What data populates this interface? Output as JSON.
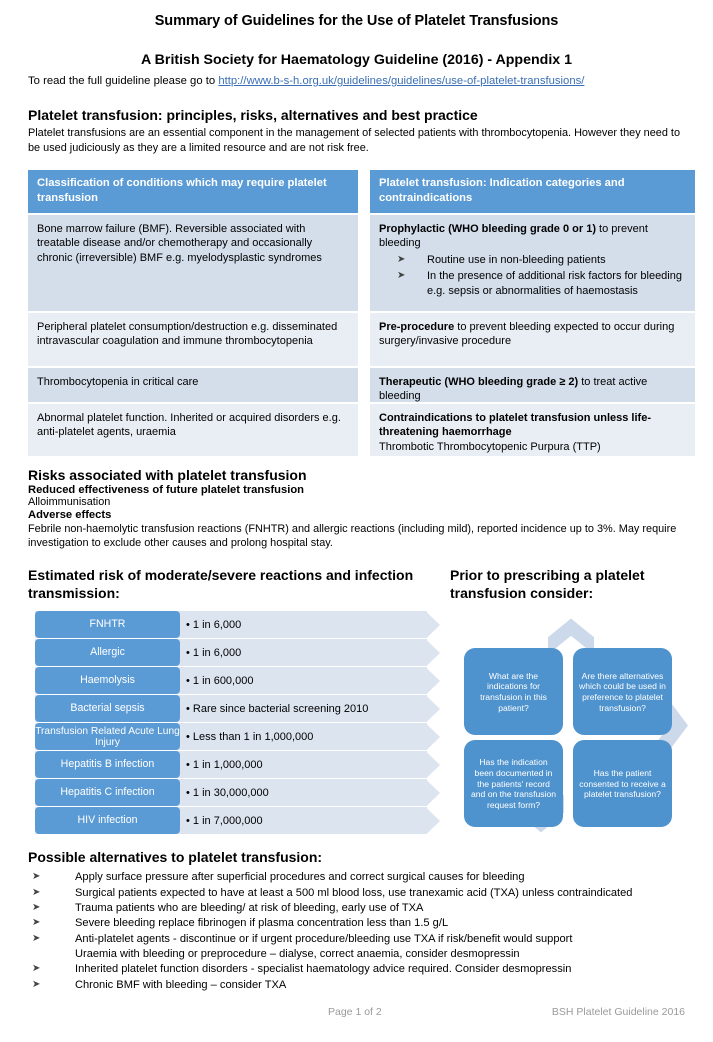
{
  "header": {
    "title": "Summary of Guidelines for the Use of Platelet Transfusions",
    "subtitle": "A British Society for Haematology Guideline (2016) -  Appendix 1",
    "link_prefix": "To read the full guideline please go to ",
    "link_url": "http://www.b-s-h.org.uk/guidelines/guidelines/use-of-platelet-transfusions/"
  },
  "overview": {
    "heading": "Platelet transfusion: principles, risks, alternatives and best practice",
    "paragraph": "Platelet transfusions are an essential component in the management of selected patients with thrombocytopenia. However they need to be used judiciously as they are a limited resource and are not risk free."
  },
  "table": {
    "left_header": "Classification of conditions which may require platelet transfusion",
    "right_header": "Platelet transfusion: Indication categories and contraindications",
    "left_rows": [
      "Bone marrow failure (BMF).  Reversible associated with treatable disease and/or chemotherapy and occasionally chronic (irreversible) BMF e.g. myelodysplastic syndromes",
      "Peripheral platelet consumption/destruction e.g. disseminated intravascular coagulation and immune thrombocytopenia",
      "Thrombocytopenia in critical care",
      "Abnormal platelet function. Inherited or acquired disorders e.g. anti-platelet agents, uraemia"
    ],
    "right_rows": [
      {
        "bold": "Prophylactic (WHO bleeding grade 0 or 1)",
        "rest": " to prevent bleeding",
        "bullets": [
          "Routine use in non-bleeding patients",
          "In the presence of additional risk factors for bleeding e.g. sepsis or abnormalities of haemostasis"
        ]
      },
      {
        "bold": "Pre-procedure",
        "rest": " to prevent bleeding expected to occur during surgery/invasive procedure",
        "bullets": []
      },
      {
        "bold": "Therapeutic (WHO bleeding grade ≥ 2)",
        "rest": "  to treat active bleeding",
        "bullets": []
      },
      {
        "bold": "Contraindications to platelet transfusion unless life-threatening haemorrhage",
        "rest": "",
        "sub": "Thrombotic Thrombocytopenic Purpura (TTP)",
        "bullets": []
      }
    ]
  },
  "risks": {
    "heading": "Risks associated with platelet transfusion",
    "bold1": "Reduced effectiveness of future platelet transfusion",
    "normal1": "Alloimmunisation",
    "bold2": "Adverse effects",
    "paragraph": "Febrile non-haemolytic transfusion reactions (FNHTR) and allergic reactions (including mild), reported incidence up to 3%. May require investigation to exclude other causes and prolong hospital stay."
  },
  "estimated_risk": {
    "heading": "Estimated risk of moderate/severe reactions and infection transmission:",
    "accent_color": "#5B9BD5",
    "track_color": "#DCE4F0"
  },
  "chart_data": {
    "type": "bar",
    "title": "Estimated risk of moderate/severe reactions and infection transmission:",
    "xlabel": "",
    "ylabel": "",
    "categories": [
      "FNHTR",
      "Allergic",
      "Haemolysis",
      "Bacterial sepsis",
      "Transfusion Related Acute Lung Injury",
      "Hepatitis B infection",
      "Hepatitis C infection",
      "HIV infection"
    ],
    "values": [
      "• 1 in 6,000",
      "• 1 in 6,000",
      "• 1 in 600,000",
      "• Rare since bacterial screening 2010",
      "• Less than 1 in 1,000,000",
      "• 1 in 1,000,000",
      "• 1 in 30,000,000",
      "• 1 in 7,000,000"
    ],
    "rows": [
      {
        "label": "FNHTR",
        "value": "• 1 in 6,000",
        "two_line": false
      },
      {
        "label": "Allergic",
        "value": "• 1 in 6,000",
        "two_line": false
      },
      {
        "label": "Haemolysis",
        "value": "• 1 in 600,000",
        "two_line": false
      },
      {
        "label": "Bacterial sepsis",
        "value": "• Rare since bacterial screening 2010",
        "two_line": false
      },
      {
        "label": "Transfusion Related Acute Lung Injury",
        "value": "• Less than 1 in 1,000,000",
        "two_line": true
      },
      {
        "label": "Hepatitis B infection",
        "value": "• 1 in 1,000,000",
        "two_line": false
      },
      {
        "label": "Hepatitis C infection",
        "value": "• 1 in 30,000,000",
        "two_line": false
      },
      {
        "label": "HIV infection",
        "value": "• 1 in 7,000,000",
        "two_line": false
      }
    ],
    "legend": [],
    "grid": false
  },
  "cycle": {
    "heading": "Prior to prescribing a platelet transfusion consider:",
    "box_color": "#4E93CE",
    "arrow_color": "#CCD9EA",
    "boxes": [
      "What are the indications for transfusion in this patient?",
      "Are there alternatives which could be used in preference to platelet transfusion?",
      "Has the indication been documented in the patients' record and on the transfusion request form?",
      "Has the patient consented to receive a platelet transfusion?"
    ]
  },
  "alternatives": {
    "heading": "Possible alternatives to platelet transfusion:",
    "items": [
      {
        "text": "Apply surface pressure after superficial procedures and correct surgical causes for bleeding",
        "bullet": true
      },
      {
        "text": "Surgical patients expected to have at least a 500 ml blood loss, use tranexamic acid (TXA) unless contraindicated",
        "bullet": true
      },
      {
        "text": "Trauma patients who are bleeding/ at risk of bleeding, early use of TXA",
        "bullet": true
      },
      {
        "text": "Severe bleeding replace fibrinogen if plasma concentration less than 1.5 g/L",
        "bullet": true
      },
      {
        "text": "Anti-platelet agents - discontinue or if urgent procedure/bleeding use TXA if risk/benefit would support",
        "bullet": true
      },
      {
        "text": "Uraemia with bleeding or preprocedure – dialyse, correct anaemia, consider desmopressin",
        "bullet": false
      },
      {
        "text": "Inherited platelet function disorders - specialist haematology advice required. Consider desmopressin",
        "bullet": true
      },
      {
        "text": "Chronic BMF with bleeding – consider TXA",
        "bullet": true
      }
    ]
  },
  "footer": {
    "page": "Page 1 of 2",
    "right": "BSH Platelet Guideline 2016"
  }
}
